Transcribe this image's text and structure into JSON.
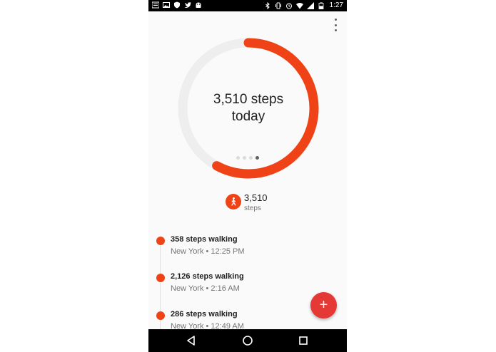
{
  "status_bar": {
    "time": "1:27",
    "battery_level": 0.55,
    "left_icons": [
      "news-icon",
      "image-icon",
      "shield-notification-icon",
      "twitter-icon",
      "android-icon"
    ],
    "right_icons": [
      "bluetooth-icon",
      "vibrate-icon",
      "alarm-icon",
      "wifi-icon",
      "signal-icon",
      "battery-icon"
    ]
  },
  "ring": {
    "value_line": "3,510 steps",
    "label_line": "today",
    "progress": 0.58,
    "colors": {
      "progress": "#ef4317",
      "track": "#eeeeee"
    },
    "page_dots": {
      "count": 4,
      "active_index": 3
    }
  },
  "summary": {
    "value": "3,510",
    "unit": "steps",
    "icon": "walking-icon"
  },
  "timeline": [
    {
      "title": "358 steps walking",
      "subtitle": "New York • 12:25 PM"
    },
    {
      "title": "2,126 steps walking",
      "subtitle": "New York • 2:16 AM"
    },
    {
      "title": "286 steps walking",
      "subtitle": "New York • 12:49 AM"
    }
  ],
  "fab": {
    "label": "+"
  },
  "nav_bar": {
    "buttons": [
      "back-icon",
      "home-icon",
      "recents-icon"
    ]
  },
  "colors": {
    "accent": "#ef4317",
    "fab": "#e53935",
    "background": "#fafafa"
  }
}
